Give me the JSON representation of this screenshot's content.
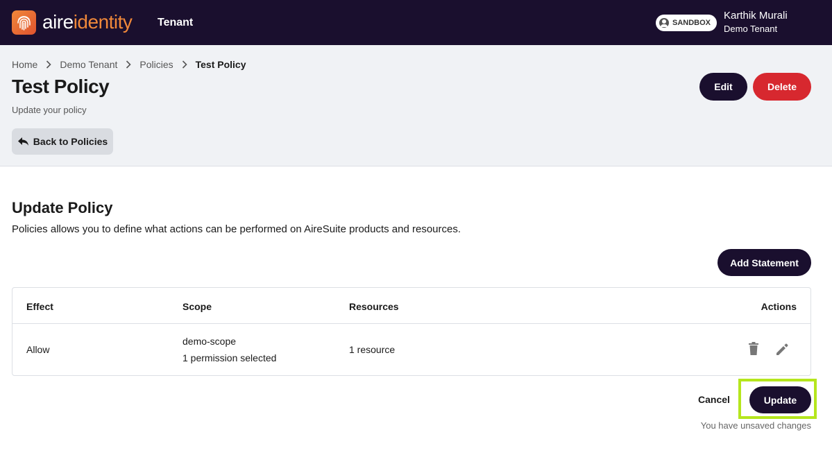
{
  "topbar": {
    "logo_part1": "aire",
    "logo_part2": "identity",
    "nav_label": "Tenant",
    "environment_badge": "SANDBOX",
    "user_name": "Karthik Murali",
    "user_tenant": "Demo Tenant"
  },
  "breadcrumb": {
    "items": [
      "Home",
      "Demo Tenant",
      "Policies"
    ],
    "current": "Test Policy"
  },
  "header": {
    "title": "Test Policy",
    "subtitle": "Update your policy",
    "back_label": "Back to Policies",
    "edit_label": "Edit",
    "delete_label": "Delete"
  },
  "section": {
    "title": "Update Policy",
    "description": "Policies allows you to define what actions can be performed on AireSuite products and resources.",
    "add_statement_label": "Add Statement"
  },
  "table": {
    "columns": [
      "Effect",
      "Scope",
      "Resources",
      "Actions"
    ],
    "rows": [
      {
        "effect": "Allow",
        "scope": "demo-scope",
        "scope_detail": "1 permission selected",
        "resources": "1 resource",
        "actions": [
          "delete-icon",
          "edit-icon"
        ]
      }
    ]
  },
  "footer": {
    "cancel_label": "Cancel",
    "update_label": "Update",
    "status_text": "You have unsaved changes"
  },
  "colors": {
    "brand_dark": "#1a0f2e",
    "brand_orange": "#f0883a",
    "danger": "#d7282f",
    "highlight": "#b5e61d"
  }
}
